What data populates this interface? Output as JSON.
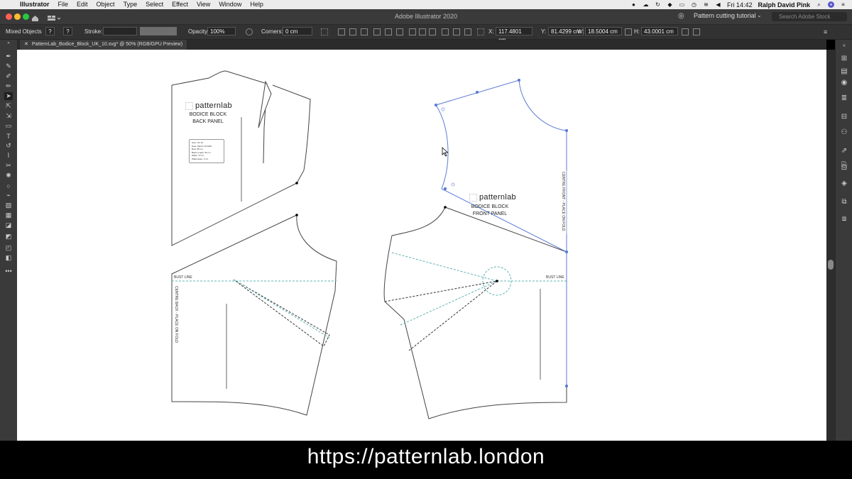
{
  "menubar": {
    "app_name": "Illustrator",
    "items": [
      "File",
      "Edit",
      "Object",
      "Type",
      "Select",
      "Effect",
      "View",
      "Window",
      "Help"
    ],
    "clock": "Fri 14:42",
    "user": "Ralph David Pink"
  },
  "window": {
    "title": "Adobe Illustrator 2020",
    "workspace": "Pattern cutting tutorial",
    "search_placeholder": "Search Adobe Stock"
  },
  "control_bar": {
    "selection_label": "Mixed Objects",
    "fill_value": "?",
    "stroke_color_value": "?",
    "stroke_label": "Stroke:",
    "opacity_label": "Opacity:",
    "opacity_value": "100%",
    "corners_label": "Corners:",
    "corners_value": "0 cm",
    "x_label": "X:",
    "x_value": "117.4801 cm",
    "y_label": "Y:",
    "y_value": "81.4299 cm",
    "w_label": "W:",
    "w_value": "18.5004 cm",
    "h_label": "H:",
    "h_value": "43.0001 cm"
  },
  "document_tab": {
    "label": "PatternLab_Bodice_Block_UK_10.svg* @ 50% (RGB/GPU Preview)"
  },
  "artwork": {
    "back_panel": {
      "brand": "patternlab",
      "title": "BODICE BLOCK",
      "subtitle": "BACK PANEL",
      "bust_line": "BUST LINE",
      "centre_label": "CENTRE BACK - PLACE ON FOLD",
      "info_lines": [
        "Size: UK 10",
        "Date: March 20 2020",
        "Bust: 88 cm",
        "Back Length: 40 cm",
        "Waist: 72 cm",
        "Waist Ease: 3 cm"
      ]
    },
    "front_panel": {
      "brand": "patternlab",
      "title": "BODICE BLOCK",
      "subtitle": "FRONT PANEL",
      "bust_line": "BUST LINE",
      "centre_label": "CENTRE FRONT - PLACE ON FOLD"
    }
  },
  "caption": "https://patternlab.london",
  "colors": {
    "selection_blue": "#5b7bd5",
    "guide_teal": "#5fb3b3",
    "canvas": "#ffffff",
    "ui_dark": "#323232"
  }
}
